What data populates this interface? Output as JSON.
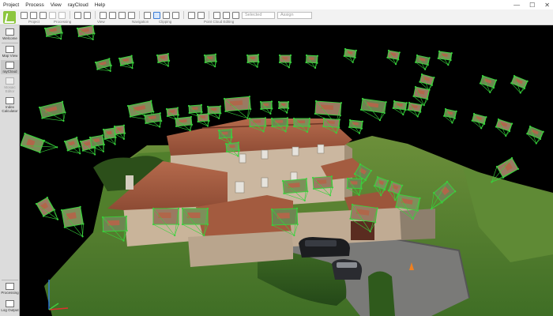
{
  "menubar": {
    "items": [
      "Project",
      "Process",
      "View",
      "rayCloud",
      "Help"
    ],
    "minimize": "—",
    "maximize": "☐",
    "close": "✕"
  },
  "toolbar": {
    "group_labels": [
      "Project",
      "Processing",
      "View",
      "Navigation",
      "Clipping",
      "Point Cloud Editing"
    ],
    "selection_set": "Selected",
    "assign": "Assign"
  },
  "sidebar": {
    "items": [
      {
        "label": "Welcome",
        "icon": "home-icon",
        "state": "normal"
      },
      {
        "label": "Map View",
        "icon": "map-icon",
        "state": "normal"
      },
      {
        "label": "rayCloud",
        "icon": "raycloud-icon",
        "state": "active"
      },
      {
        "label": "Mosaic Editor",
        "icon": "mosaic-icon",
        "state": "disabled"
      },
      {
        "label": "Index Calculator",
        "icon": "calculator-icon",
        "state": "normal"
      }
    ],
    "bottom_items": [
      {
        "label": "Processing",
        "icon": "processing-icon"
      },
      {
        "label": "Log Output",
        "icon": "log-icon"
      }
    ]
  },
  "colors": {
    "camera_green": "#37d43c",
    "background": "#000000",
    "logo": "#8dc63f"
  }
}
